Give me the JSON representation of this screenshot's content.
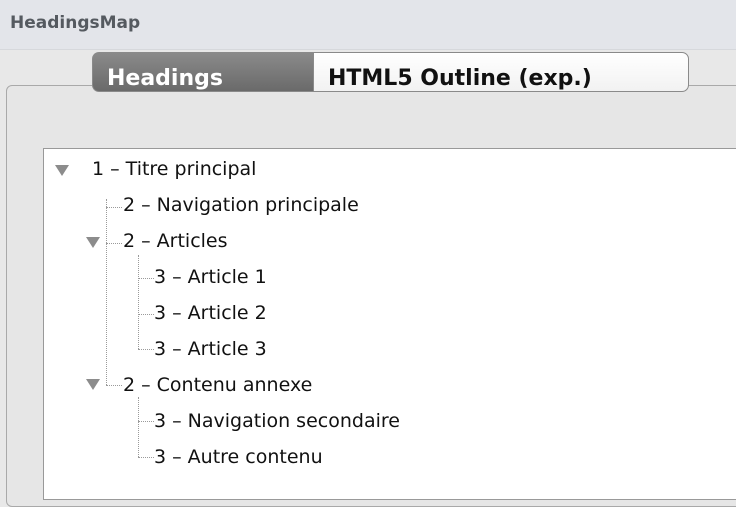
{
  "app": {
    "title": "HeadingsMap"
  },
  "tabs": [
    {
      "label": "Headings",
      "active": true
    },
    {
      "label": "HTML5 Outline (exp.)",
      "active": false
    }
  ],
  "tree": {
    "nodes": [
      {
        "label": "1 – Titre principal",
        "level": 1,
        "expandable": true,
        "expanded": true
      },
      {
        "label": "2 – Navigation principale",
        "level": 2,
        "expandable": false
      },
      {
        "label": "2 – Articles",
        "level": 2,
        "expandable": true,
        "expanded": true
      },
      {
        "label": "3 – Article 1",
        "level": 3,
        "expandable": false
      },
      {
        "label": "3 – Article 2",
        "level": 3,
        "expandable": false
      },
      {
        "label": "3 – Article 3",
        "level": 3,
        "expandable": false
      },
      {
        "label": "2 – Contenu annexe",
        "level": 2,
        "expandable": true,
        "expanded": true
      },
      {
        "label": "3 – Navigation secondaire",
        "level": 3,
        "expandable": false
      },
      {
        "label": "3 – Autre contenu",
        "level": 3,
        "expandable": false
      }
    ]
  },
  "colors": {
    "titlebar": "#e3e5ea",
    "active_tab": "#7a7a7a",
    "twisty": "#8c8c8c"
  }
}
